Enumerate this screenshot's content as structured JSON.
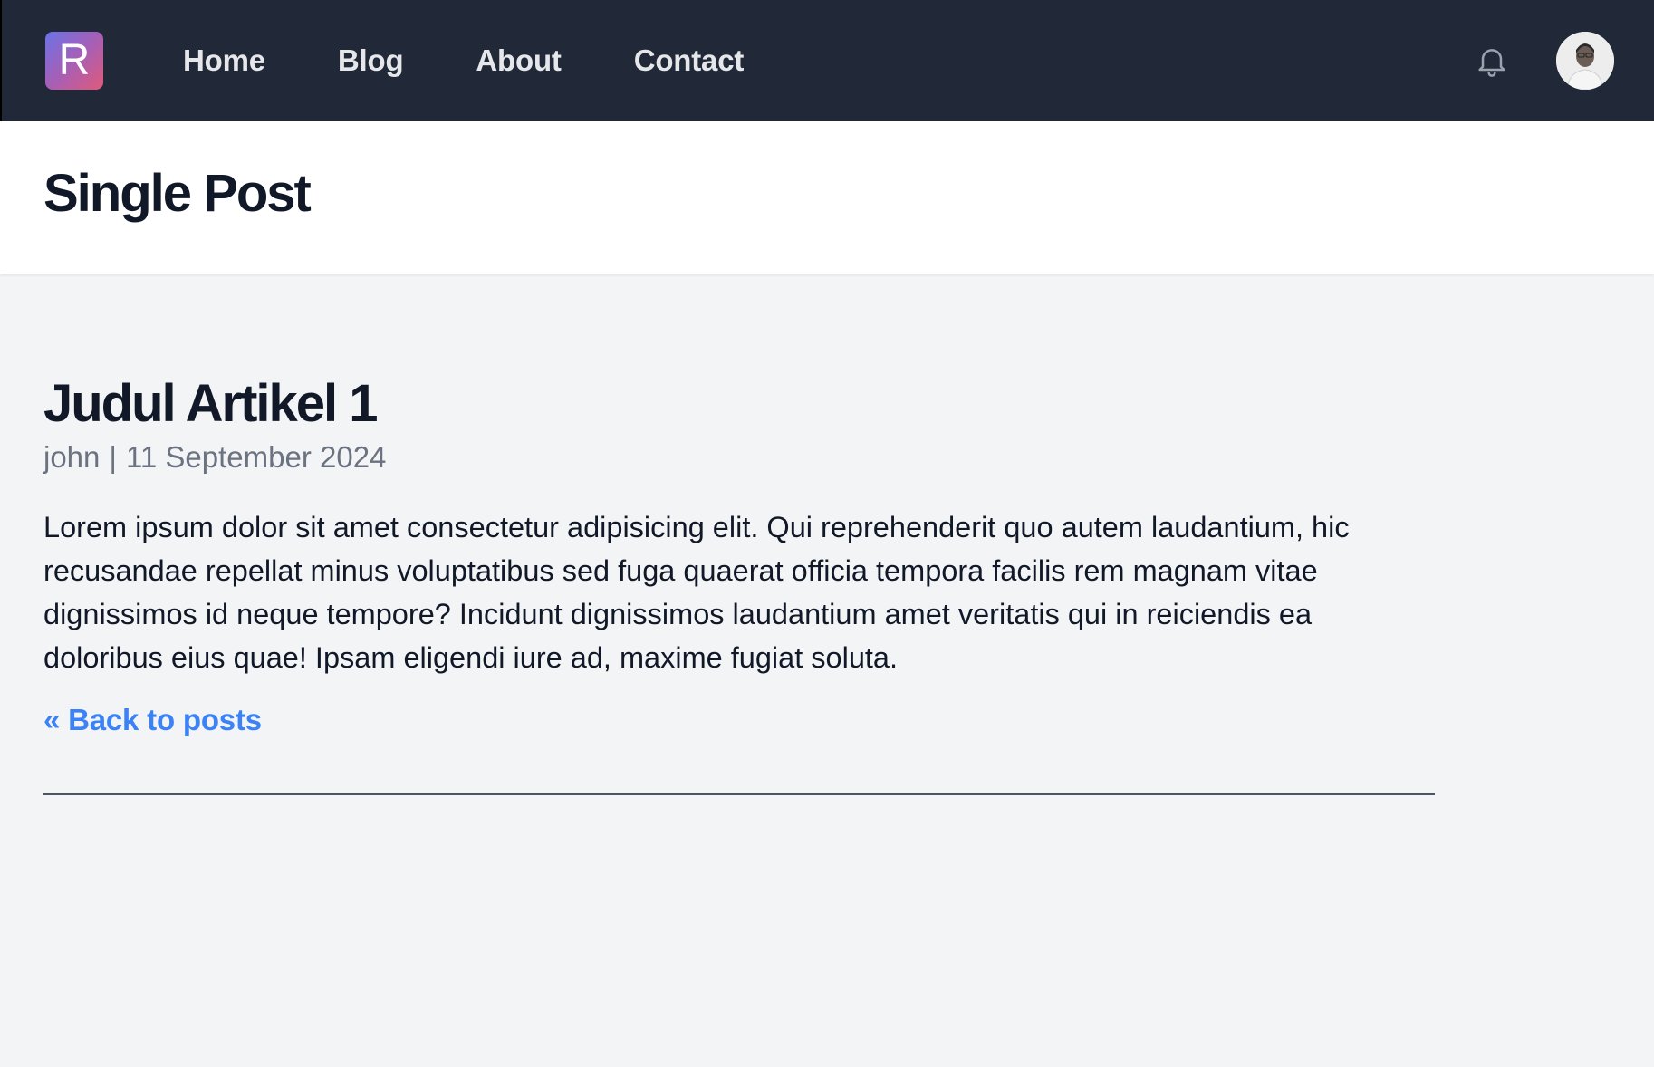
{
  "navbar": {
    "logo_letter": "R",
    "links": [
      {
        "label": "Home"
      },
      {
        "label": "Blog"
      },
      {
        "label": "About"
      },
      {
        "label": "Contact"
      }
    ],
    "notification_icon": "bell-icon",
    "avatar_icon": "user-avatar"
  },
  "header": {
    "title": "Single Post"
  },
  "post": {
    "title": "Judul Artikel 1",
    "author": "john",
    "separator": "|",
    "date": "11 September 2024",
    "body": "Lorem ipsum dolor sit amet consectetur adipisicing elit. Qui reprehenderit quo autem laudantium, hic recusandae repellat minus voluptatibus sed fuga quaerat officia tempora facilis rem magnam vitae dignissimos id neque tempore? Incidunt dignissimos laudantium amet veritatis qui in reiciendis ea doloribus eius quae! Ipsam eligendi iure ad, maxime fugiat soluta.",
    "back_link": "« Back to posts"
  },
  "colors": {
    "navbar_bg": "#212837",
    "page_bg": "#f3f4f6",
    "link_blue": "#3b82f6",
    "muted_text": "#6b7280"
  }
}
